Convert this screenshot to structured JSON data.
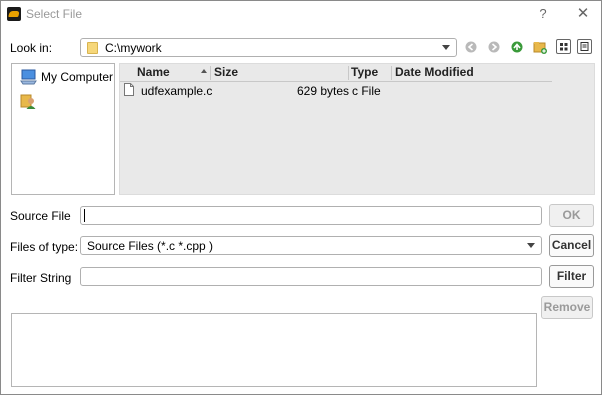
{
  "window": {
    "title": "Select File",
    "help_label": "?",
    "close_label": "✕",
    "app_icon": "app-logo-icon"
  },
  "lookin": {
    "label": "Look in:",
    "value": "C:\\mywork",
    "icon": "folder-icon"
  },
  "toolbar": {
    "icons": [
      "back-arrow-icon",
      "forward-arrow-icon",
      "up-folder-icon",
      "new-folder-icon",
      "list-view-icon",
      "detail-view-icon"
    ]
  },
  "places": {
    "items": [
      {
        "label": "My Computer",
        "icon": "computer-icon"
      },
      {
        "label": "",
        "icon": "user-folder-icon"
      }
    ]
  },
  "filelist": {
    "columns": [
      "Name",
      "Size",
      "Type",
      "Date Modified"
    ],
    "rows": [
      {
        "name": "udfexample.c",
        "size": "629 bytes",
        "type": "c File",
        "date": ""
      }
    ]
  },
  "source": {
    "label": "Source File",
    "value": ""
  },
  "filetype": {
    "label": "Files of type:",
    "value": "Source Files (*.c *.cpp )"
  },
  "filter": {
    "label": "Filter String",
    "value": ""
  },
  "buttons": {
    "ok": "OK",
    "cancel": "Cancel",
    "filter": "Filter",
    "remove": "Remove"
  },
  "colors": {
    "accent_green": "#3a9a3a",
    "folder_yellow": "#f6d77a",
    "list_bg": "#e9e9e9"
  }
}
